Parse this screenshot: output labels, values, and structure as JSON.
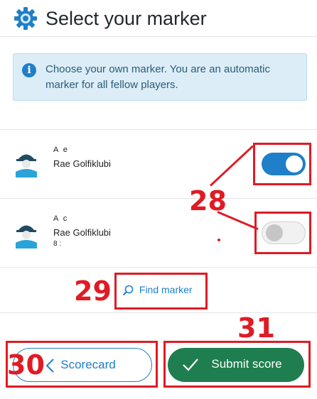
{
  "header": {
    "title": "Select your marker",
    "icon": "gear-icon"
  },
  "info": {
    "icon": "info-icon",
    "text": "Choose your own marker. You are an automatic marker for all fellow players."
  },
  "players": [
    {
      "name": "A                    e",
      "club": "Rae Golfiklubi",
      "extra": "",
      "marker_selected": true
    },
    {
      "name": "A                    c",
      "club": "Rae Golfiklubi",
      "extra": "8  :",
      "marker_selected": false
    }
  ],
  "find_marker": {
    "label": "Find marker",
    "icon": "search-icon"
  },
  "buttons": {
    "scorecard": "Scorecard",
    "submit": "Submit score"
  },
  "annotations": {
    "toggles": "28",
    "find": "29",
    "scorecard": "30",
    "submit": "31"
  },
  "colors": {
    "accent_blue": "#1f7fc8",
    "submit_green": "#1e7e50",
    "annotation_red": "#e01b24",
    "info_bg": "#dcedf7"
  }
}
